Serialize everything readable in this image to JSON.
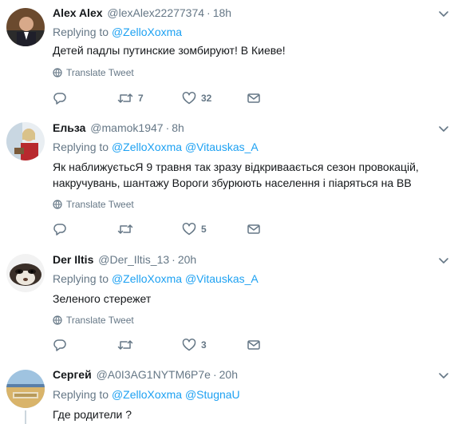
{
  "replying_label": "Replying to",
  "translate_label": "Translate Tweet",
  "tweets": [
    {
      "name": "Alex Alex",
      "handle": "@lexAlex22277374",
      "dot": "·",
      "time": "18h",
      "mention1": "@ZelloXoxma",
      "mention2": "",
      "text": "Детей падлы путинские зомбируют! В Киеве!",
      "replies": "",
      "retweets": "7",
      "likes": "32"
    },
    {
      "name": "Ельза",
      "handle": "@mamok1947",
      "dot": "·",
      "time": "8h",
      "mention1": "@ZelloXoxma",
      "mention2": "@Vitauskas_A",
      "text": "Як наближуєтьсЯ 9 травня так зразу відкриваається сезон провокацій, накручувань, шантажу  Вороги збурюють населення і піаряться на ВВ",
      "replies": "",
      "retweets": "",
      "likes": "5"
    },
    {
      "name": "Der Iltis",
      "handle": "@Der_Iltis_13",
      "dot": "·",
      "time": "20h",
      "mention1": "@ZelloXoxma",
      "mention2": "@Vitauskas_A",
      "text": "Зеленого стережет",
      "replies": "",
      "retweets": "",
      "likes": "3"
    },
    {
      "name": "Сергей",
      "handle": "@A0I3AG1NYTM6P7e",
      "dot": "·",
      "time": "20h",
      "mention1": "@ZelloXoxma",
      "mention2": "@StugnaU",
      "text": "Где родители ?",
      "replies": "",
      "retweets": "",
      "likes": ""
    }
  ],
  "icons": {
    "caret": "chevron-down-icon",
    "globe": "globe-icon",
    "reply": "reply-icon",
    "retweet": "retweet-icon",
    "like": "heart-icon",
    "dm": "envelope-icon"
  },
  "colors": {
    "link": "#1da1f2",
    "muted": "#657786",
    "text": "#14171a",
    "divider": "#e6ecf0"
  }
}
